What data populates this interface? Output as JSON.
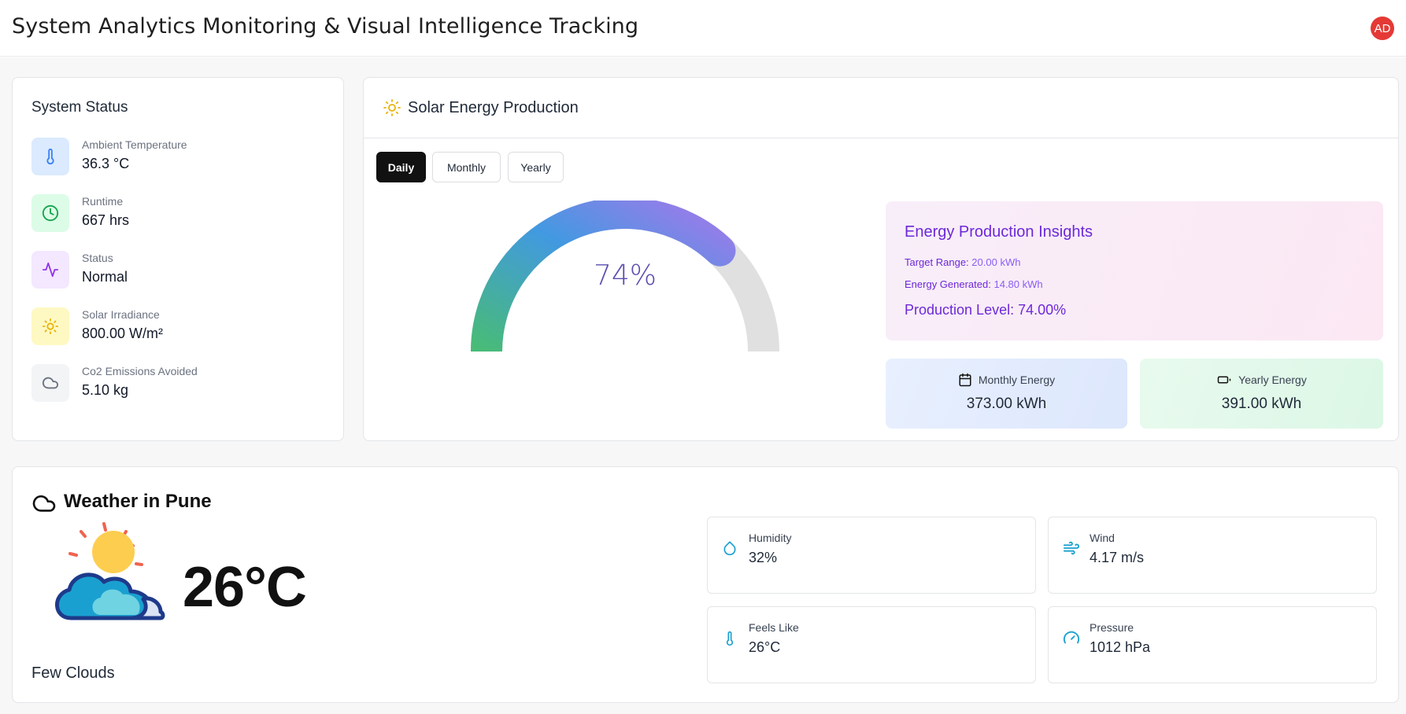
{
  "header": {
    "title": "System Analytics Monitoring & Visual Intelligence Tracking",
    "avatar_initials": "AD"
  },
  "system_status": {
    "title": "System Status",
    "items": [
      {
        "label": "Ambient Temperature",
        "value": "36.3 °C",
        "icon": "thermometer-icon",
        "bg": "#dbeafe",
        "color": "#3b82f6"
      },
      {
        "label": "Runtime",
        "value": "667 hrs",
        "icon": "clock-icon",
        "bg": "#dcfce7",
        "color": "#16a34a"
      },
      {
        "label": "Status",
        "value": "Normal",
        "icon": "activity-icon",
        "bg": "#f3e8ff",
        "color": "#9333ea"
      },
      {
        "label": "Solar Irradiance",
        "value": "800.00 W/m²",
        "icon": "sun-icon",
        "bg": "#fef9c3",
        "color": "#eab308"
      },
      {
        "label": "Co2 Emissions Avoided",
        "value": "5.10 kg",
        "icon": "cloud-icon",
        "bg": "#f3f4f6",
        "color": "#6b7280"
      }
    ]
  },
  "solar": {
    "title": "Solar Energy Production",
    "tabs": [
      {
        "label": "Daily",
        "active": true
      },
      {
        "label": "Monthly",
        "active": false
      },
      {
        "label": "Yearly",
        "active": false
      }
    ],
    "gauge": {
      "percent_text": "74%",
      "fraction": 0.74
    },
    "insights": {
      "title": "Energy Production Insights",
      "target_label": "Target Range:",
      "target_value": "20.00 kWh",
      "generated_label": "Energy Generated:",
      "generated_value": "14.80 kWh",
      "level": "Production Level: 74.00%"
    },
    "monthly": {
      "label": "Monthly Energy",
      "value": "373.00 kWh",
      "icon": "calendar-icon"
    },
    "yearly": {
      "label": "Yearly Energy",
      "value": "391.00 kWh",
      "icon": "battery-icon"
    }
  },
  "weather": {
    "title": "Weather in Pune",
    "temperature": "26°C",
    "description": "Few Clouds",
    "details": [
      {
        "label": "Humidity",
        "value": "32%",
        "icon": "droplet-icon"
      },
      {
        "label": "Wind",
        "value": "4.17 m/s",
        "icon": "wind-icon"
      },
      {
        "label": "Feels Like",
        "value": "26°C",
        "icon": "thermometer-icon"
      },
      {
        "label": "Pressure",
        "value": "1012 hPa",
        "icon": "gauge-icon"
      }
    ]
  }
}
